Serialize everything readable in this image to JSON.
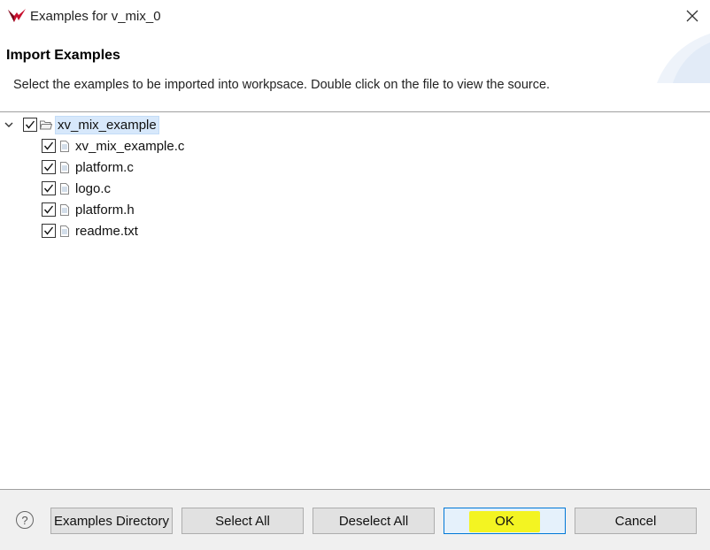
{
  "window": {
    "title": "Examples for v_mix_0",
    "close_icon": "close-icon",
    "logo_icon": "vivado-logo-icon",
    "brand_color": "#c8102e"
  },
  "header": {
    "title": "Import Examples",
    "description": "Select the examples to be imported into workpsace. Double click on the file to view the source."
  },
  "tree": {
    "root": {
      "label": "xv_mix_example",
      "checked": true,
      "expanded": true,
      "selected": true,
      "icon": "folder-icon"
    },
    "children": [
      {
        "label": "xv_mix_example.c",
        "checked": true,
        "icon": "file-icon"
      },
      {
        "label": "platform.c",
        "checked": true,
        "icon": "file-icon"
      },
      {
        "label": "logo.c",
        "checked": true,
        "icon": "file-icon"
      },
      {
        "label": "platform.h",
        "checked": true,
        "icon": "file-icon"
      },
      {
        "label": "readme.txt",
        "checked": true,
        "icon": "file-icon"
      }
    ]
  },
  "footer": {
    "help_label": "?",
    "buttons": {
      "examples_directory": "Examples Directory",
      "select_all": "Select All",
      "deselect_all": "Deselect All",
      "ok": "OK",
      "cancel": "Cancel"
    },
    "ok_highlight_color": "#f4f40a",
    "primary_border_color": "#0078d7"
  }
}
